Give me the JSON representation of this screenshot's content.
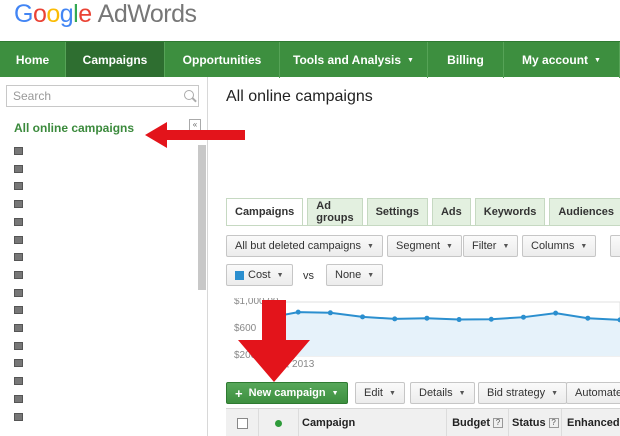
{
  "logo": {
    "google": "Google",
    "product": "AdWords"
  },
  "nav": [
    {
      "label": "Home",
      "width": 66,
      "active": false,
      "caret": ""
    },
    {
      "label": "Campaigns",
      "width": 99,
      "active": true,
      "caret": ""
    },
    {
      "label": "Opportunities",
      "width": 115,
      "active": false,
      "caret": ""
    },
    {
      "label": "Tools and Analysis",
      "width": 148,
      "active": false,
      "caret": "▼"
    },
    {
      "label": "Billing",
      "width": 76,
      "active": false,
      "caret": ""
    },
    {
      "label": "My account",
      "width": 116,
      "active": false,
      "caret": "▼"
    }
  ],
  "sidebar": {
    "search_placeholder": "Search",
    "all_campaigns_label": "All online campaigns",
    "collapse_icon": "«",
    "campaign_icon_count": 16
  },
  "main": {
    "title": "All online campaigns",
    "tabs": [
      "Campaigns",
      "Ad groups",
      "Settings",
      "Ads",
      "Keywords",
      "Audiences"
    ],
    "filter_bar": {
      "deleted_filter": "All but deleted campaigns",
      "segment": "Segment",
      "filter": "Filter",
      "columns": "Columns"
    },
    "metrics": {
      "metric1": "Cost",
      "vs": "vs",
      "metric2": "None",
      "metric1_color": "#2b8fcf"
    },
    "toolbar": {
      "new_campaign": "New campaign",
      "edit": "Edit",
      "details": "Details",
      "bid_strategy": "Bid strategy",
      "automate": "Automate"
    },
    "table_headers": {
      "campaign": "Campaign",
      "budget": "Budget",
      "status": "Status",
      "enhanced": "Enhanced",
      "help_glyph": "?"
    }
  },
  "chart_data": {
    "type": "line",
    "title": "",
    "ylabel_ticks": [
      "$1,000.00",
      "$600",
      "$200"
    ],
    "x_tick_label": "Jan 1, 2013",
    "series": [
      {
        "values": [
          760,
          850,
          840,
          780,
          750,
          760,
          740,
          745,
          775,
          835,
          760,
          735
        ]
      }
    ],
    "line_color": "#2b8fcf",
    "fill_color": "#e6f2fa"
  },
  "arrows": {
    "color": "#e3141b"
  }
}
